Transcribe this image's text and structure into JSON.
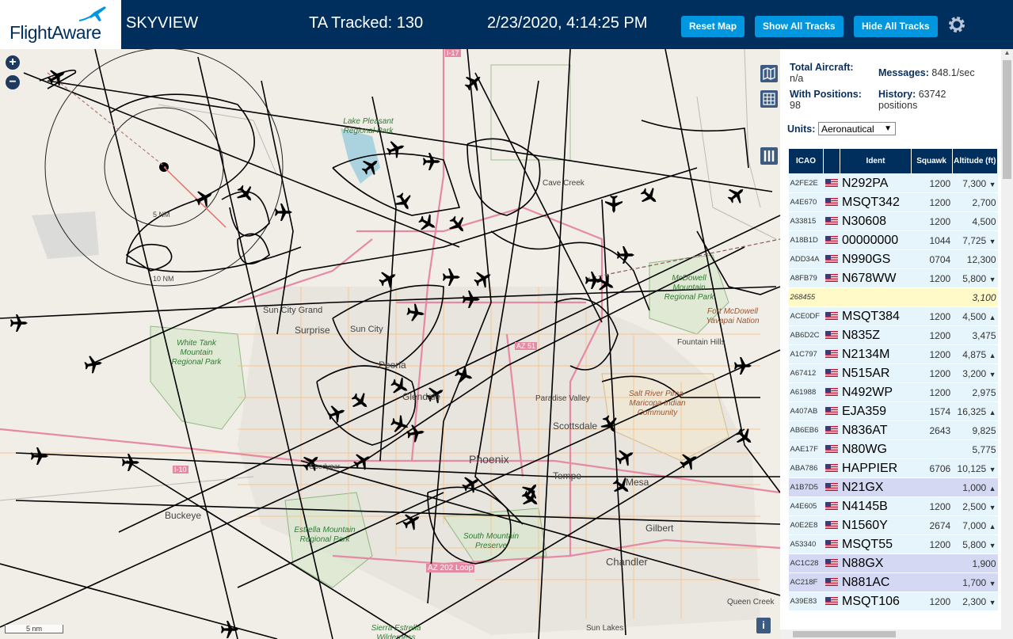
{
  "header": {
    "logo_text": "FlightAware",
    "app_name": "SKYVIEW",
    "tracked": "TA Tracked: 130",
    "datetime": "2/23/2020, 4:14:25 PM",
    "buttons": {
      "reset_map": "Reset Map",
      "show_all": "Show All Tracks",
      "hide_all": "Hide All Tracks"
    }
  },
  "map": {
    "zoom_in": "+",
    "zoom_out": "−",
    "scale": "5 nm",
    "info": "i",
    "range_labels": [
      "5 NM",
      "10 NM"
    ],
    "places": [
      "Surprise",
      "Sun City",
      "Sun City Grand",
      "Peoria",
      "Glendale",
      "Phoenix",
      "Tempe",
      "Mesa",
      "Gilbert",
      "Chandler",
      "Buckeye",
      "Goodyear",
      "Scottsdale",
      "Paradise Valley",
      "Fountain Hills",
      "Cave Creek",
      "Queen Creek",
      "Sun Lakes",
      "Lake Pleasant Regional Park",
      "AZ 51",
      "I-17",
      "I-10",
      "AZ 202 Loop"
    ],
    "parks": [
      "White Tank Mountain Regional Park",
      "Estrella Mountain Regional Park",
      "South Mountain Preserve",
      "McDowell Mountain Regional Park",
      "Fort McDowell Yavapai Nation",
      "Salt River Pima-Maricopa Indian Community",
      "Sierra Estrella Wilderness"
    ]
  },
  "sidebar": {
    "total_label": "Total Aircraft:",
    "total_value": "n/a",
    "messages_label": "Messages:",
    "messages_value": "848.1/sec",
    "positions_label": "With Positions:",
    "positions_value": "98",
    "history_label": "History:",
    "history_value": "63742",
    "history_unit": "positions",
    "units_label": "Units:",
    "units_value": "Aeronautical"
  },
  "table": {
    "headers": [
      "ICAO",
      "",
      "Ident",
      "Squawk",
      "Altitude (ft)"
    ],
    "rows": [
      {
        "icao": "A2FE2E",
        "ident": "N292PA",
        "squawk": "1200",
        "alt": "7,300",
        "trend": "▼",
        "style": "r"
      },
      {
        "icao": "A4E670",
        "ident": "MSQT342",
        "squawk": "1200",
        "alt": "2,700",
        "trend": "",
        "style": "r"
      },
      {
        "icao": "A33815",
        "ident": "N30608",
        "squawk": "1200",
        "alt": "4,500",
        "trend": "",
        "style": "r"
      },
      {
        "icao": "A18B1D",
        "ident": "00000000",
        "squawk": "1044",
        "alt": "7,725",
        "trend": "▼",
        "style": "r"
      },
      {
        "icao": "ADD34A",
        "ident": "N990GS",
        "squawk": "0704",
        "alt": "12,300",
        "trend": "",
        "style": "r"
      },
      {
        "icao": "A8FB79",
        "ident": "N678WW",
        "squawk": "1200",
        "alt": "5,800",
        "trend": "▼",
        "style": "r"
      },
      {
        "icao": "268455",
        "ident": "",
        "squawk": "",
        "alt": "3,100",
        "trend": "",
        "style": "sel"
      },
      {
        "icao": "ACE0DF",
        "ident": "MSQT384",
        "squawk": "1200",
        "alt": "4,500",
        "trend": "▲",
        "style": "r"
      },
      {
        "icao": "AB6D2C",
        "ident": "N835Z",
        "squawk": "1200",
        "alt": "3,475",
        "trend": "",
        "style": "r"
      },
      {
        "icao": "A1C797",
        "ident": "N2134M",
        "squawk": "1200",
        "alt": "4,875",
        "trend": "▲",
        "style": "r"
      },
      {
        "icao": "A67412",
        "ident": "N515AR",
        "squawk": "1200",
        "alt": "3,200",
        "trend": "▼",
        "style": "r"
      },
      {
        "icao": "A61988",
        "ident": "N492WP",
        "squawk": "1200",
        "alt": "2,975",
        "trend": "",
        "style": "r"
      },
      {
        "icao": "A407AB",
        "ident": "EJA359",
        "squawk": "1574",
        "alt": "16,325",
        "trend": "▲",
        "style": "r"
      },
      {
        "icao": "AB6EB6",
        "ident": "N836AT",
        "squawk": "2643",
        "alt": "9,825",
        "trend": "",
        "style": "r"
      },
      {
        "icao": "AAE17F",
        "ident": "N80WG",
        "squawk": "",
        "alt": "5,775",
        "trend": "",
        "style": "r"
      },
      {
        "icao": "ABA786",
        "ident": "HAPPIER",
        "squawk": "6706",
        "alt": "10,125",
        "trend": "▼",
        "style": "r"
      },
      {
        "icao": "A1B7D5",
        "ident": "N21GX",
        "squawk": "",
        "alt": "1,000",
        "trend": "▲",
        "style": "blue"
      },
      {
        "icao": "A4E605",
        "ident": "N4145B",
        "squawk": "1200",
        "alt": "2,500",
        "trend": "▼",
        "style": "r"
      },
      {
        "icao": "A0E2E8",
        "ident": "N1560Y",
        "squawk": "2674",
        "alt": "7,000",
        "trend": "▲",
        "style": "r"
      },
      {
        "icao": "A53340",
        "ident": "MSQT55",
        "squawk": "1200",
        "alt": "5,800",
        "trend": "▼",
        "style": "r"
      },
      {
        "icao": "AC1C28",
        "ident": "N88GX",
        "squawk": "",
        "alt": "1,900",
        "trend": "",
        "style": "blue"
      },
      {
        "icao": "AC218F",
        "ident": "N881AC",
        "squawk": "",
        "alt": "1,700",
        "trend": "▼",
        "style": "blue"
      },
      {
        "icao": "A39E83",
        "ident": "MSQT106",
        "squawk": "1200",
        "alt": "2,300",
        "trend": "▼",
        "style": "r"
      }
    ]
  }
}
